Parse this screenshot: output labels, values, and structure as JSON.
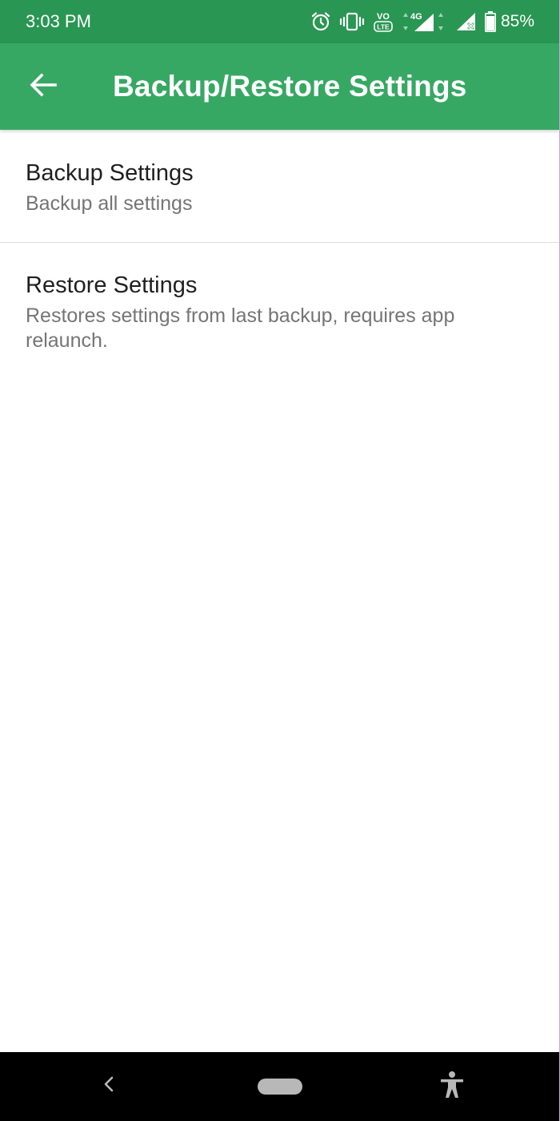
{
  "status_bar": {
    "time": "3:03 PM",
    "battery_percent": "85%",
    "network_label": "4G",
    "volte_label_top": "VO",
    "volte_label_bottom": "LTE",
    "icons": [
      "alarm-icon",
      "vibrate-icon",
      "volte-icon",
      "signal-4g-icon",
      "signal-no-sim-icon",
      "battery-icon"
    ]
  },
  "app_bar": {
    "title": "Backup/Restore Settings",
    "back_icon": "arrow-back-icon",
    "background_color": "#37a863",
    "status_color": "#2a9653"
  },
  "preferences": [
    {
      "title": "Backup Settings",
      "summary": "Backup all settings"
    },
    {
      "title": "Restore Settings",
      "summary": "Restores settings from last backup, requires app relaunch."
    }
  ],
  "nav_bar": {
    "icons": [
      "nav-back-icon",
      "home-pill-icon",
      "accessibility-icon"
    ]
  }
}
